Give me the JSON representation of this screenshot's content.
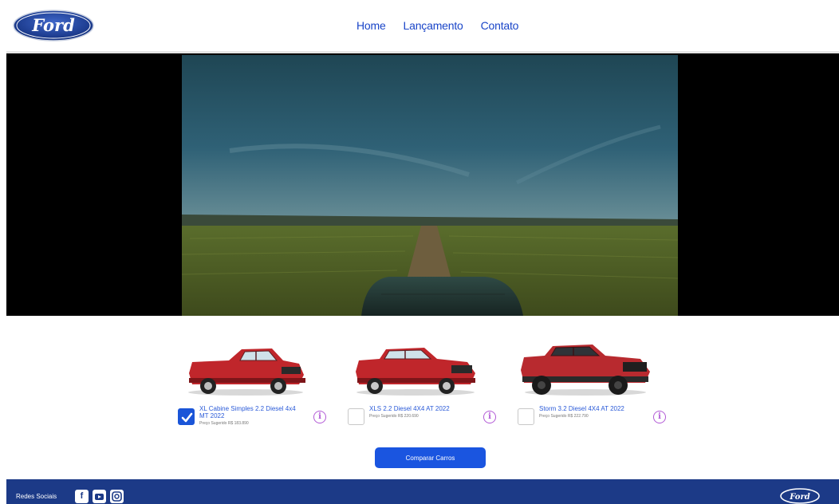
{
  "header": {
    "logo_text": "Ford",
    "nav": [
      {
        "label": "Home"
      },
      {
        "label": "Lançamento"
      },
      {
        "label": "Contato"
      }
    ]
  },
  "cars": [
    {
      "name": "XL Cabine Simples 2.2 Diesel 4x4 MT 2022",
      "price": "Preço Sugerido R$ 183.890",
      "checked": true,
      "color": "#c0262b"
    },
    {
      "name": "XLS 2.2 Diesel 4X4 AT 2022",
      "price": "Preço Sugerido R$ 220.690",
      "checked": false,
      "color": "#c0262b"
    },
    {
      "name": "Storm 3.2 Diesel 4X4 AT 2022",
      "price": "Preço Sugerido R$ 222.790",
      "checked": false,
      "color": "#b82a2f"
    }
  ],
  "compare_button": "Comparar Carros",
  "footer": {
    "social_label": "Redes Sociais",
    "social_icons": [
      "facebook-icon",
      "youtube-icon",
      "instagram-icon"
    ],
    "logo_text": "Ford"
  },
  "colors": {
    "brand_blue": "#1c3a87",
    "link_blue": "#1a45c8",
    "button_blue": "#1a55e0",
    "info_purple": "#b25ad6"
  }
}
